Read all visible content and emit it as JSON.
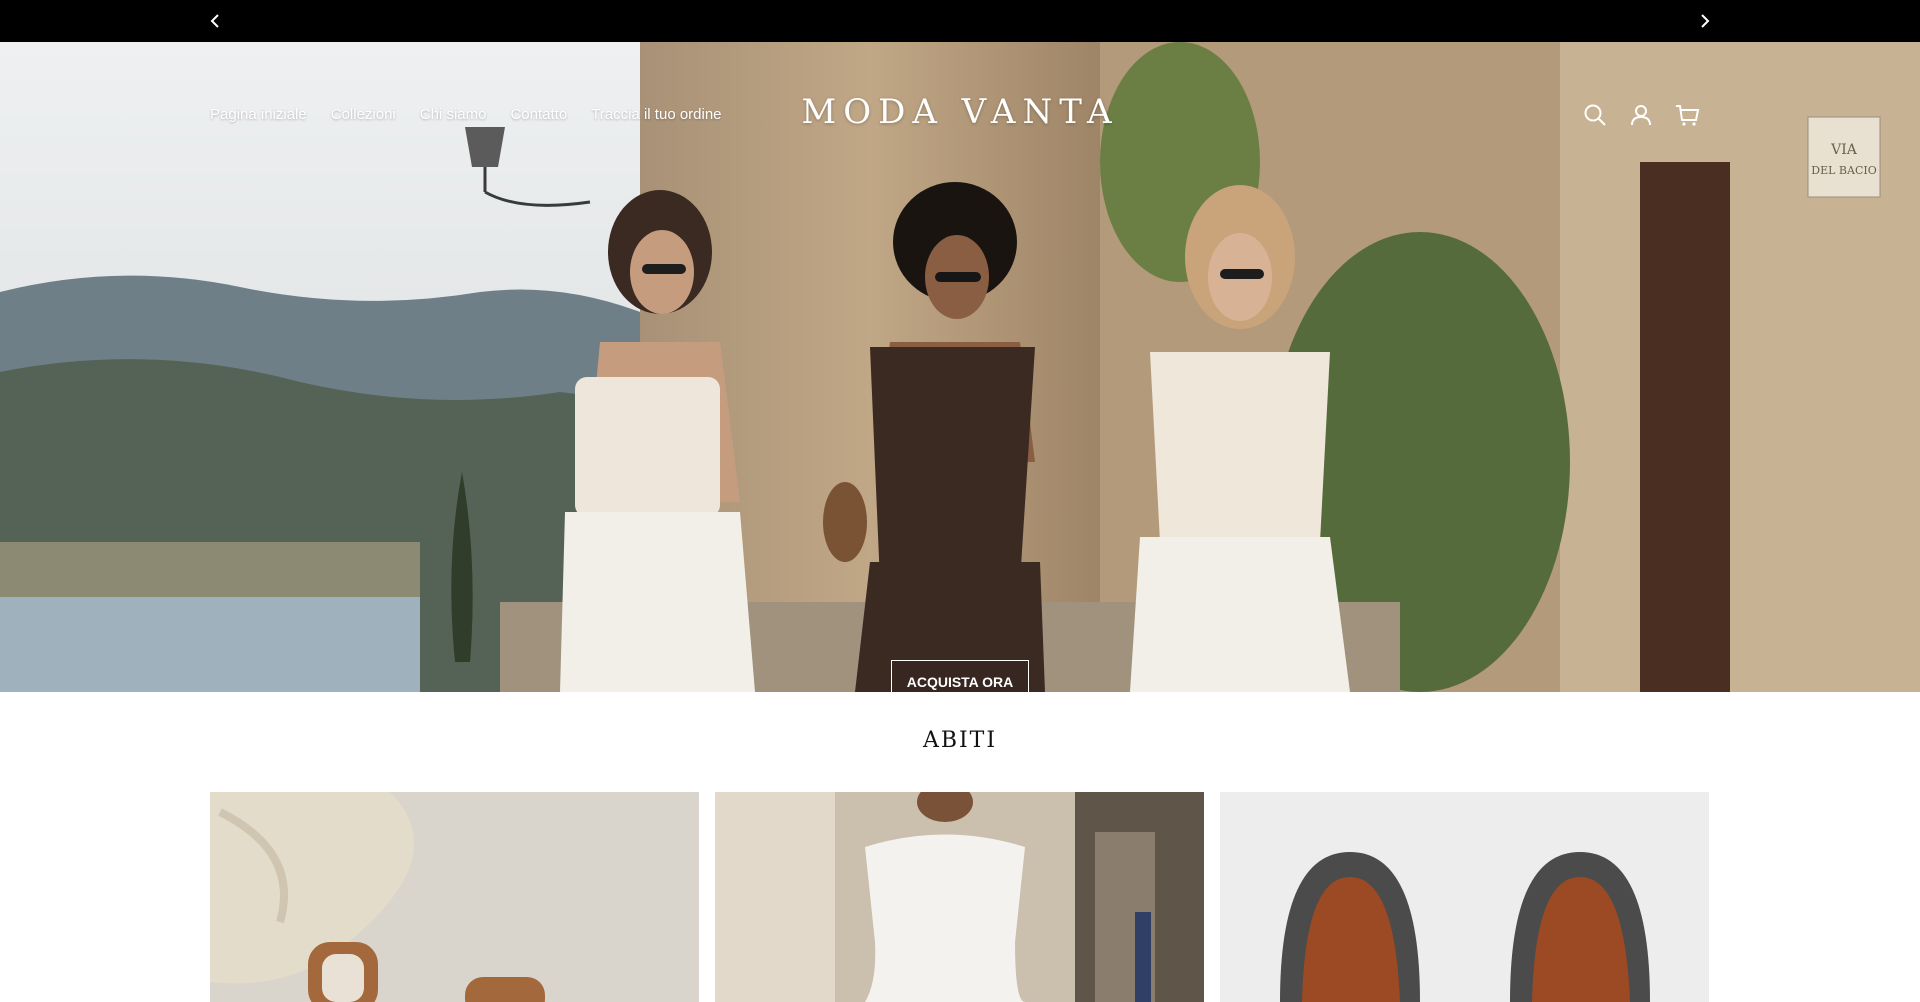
{
  "announcement": {
    "prev_icon": "chevron-left-icon",
    "next_icon": "chevron-right-icon"
  },
  "header": {
    "nav": [
      {
        "label": "Pagina iniziale"
      },
      {
        "label": "Collezioni"
      },
      {
        "label": "Chi siamo"
      },
      {
        "label": "Contatto"
      },
      {
        "label": "Traccia il tuo ordine"
      }
    ],
    "logo": "MODA VANTA",
    "icons": [
      "search-icon",
      "account-icon",
      "cart-icon"
    ]
  },
  "hero": {
    "cta_label": "ACQUISTA ORA",
    "sign_text_1": "VIA",
    "sign_text_2": "DEL BACIO"
  },
  "collection": {
    "title": "ABITI"
  },
  "colors": {
    "announcement_bg": "#000000",
    "text_on_hero": "#ffffff",
    "page_bg": "#ffffff"
  }
}
